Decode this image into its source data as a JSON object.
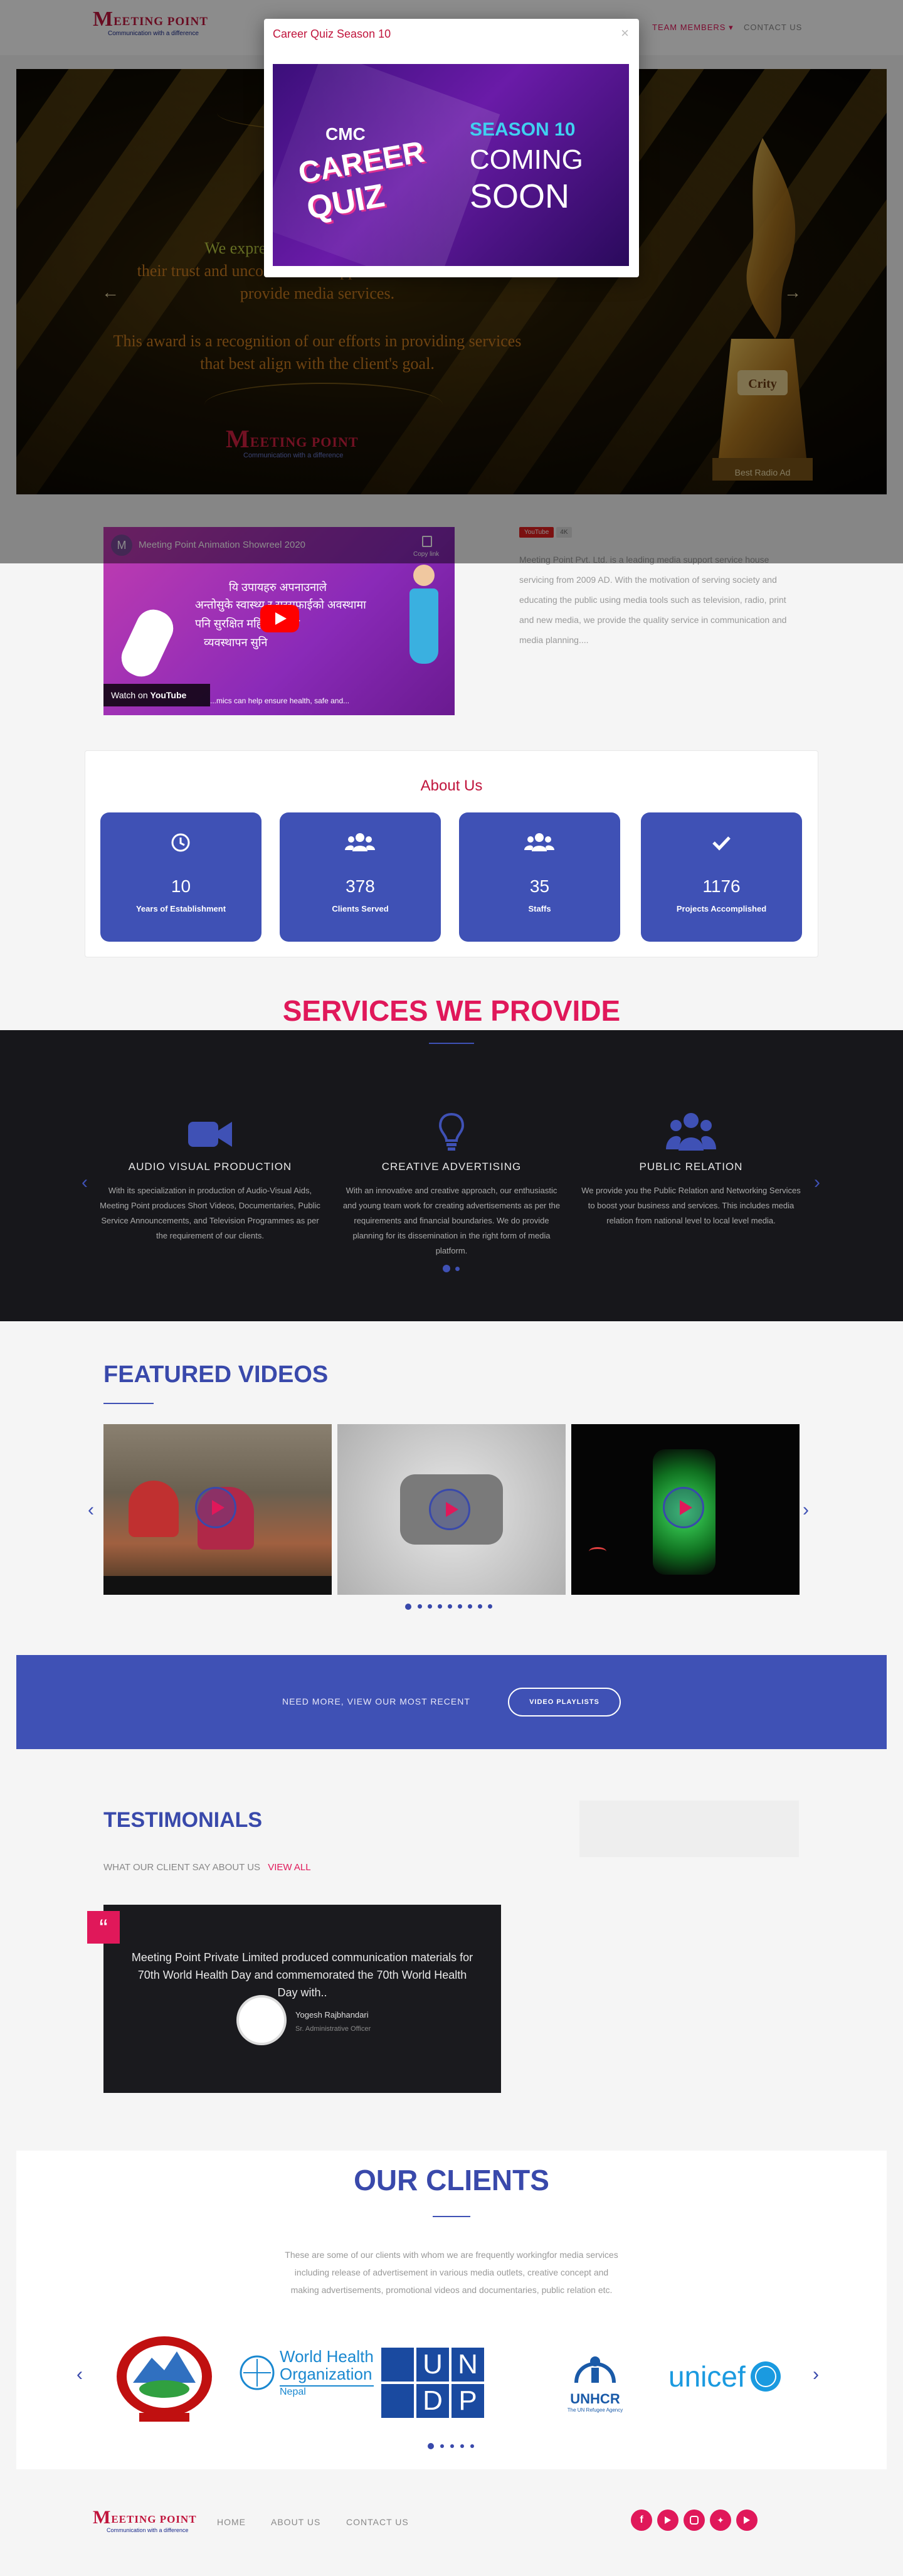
{
  "header": {
    "logo_text": "EETING POINT",
    "logo_letter": "M",
    "logo_tagline": "Communication with a difference",
    "nav": [
      "TEAM MEMBERS",
      "CONTACT US"
    ],
    "nav_caret": "▾"
  },
  "hero": {
    "text1": "We express our",
    "text2": "their trust and unconditional support in our endeavor to",
    "text3": "provide media services.",
    "text4": "This award is a recognition of our efforts in providing services",
    "text5": "that best align with the client's goal.",
    "prev_arrow": "←",
    "next_arrow": "→",
    "trophy_label": "Crity",
    "trophy_caption": "Best Radio Ad"
  },
  "modal": {
    "title": "Career Quiz Season 10",
    "close": "×",
    "img_cmc": "CMC",
    "img_career": "CAREER",
    "img_quiz": "QUIZ",
    "img_season": "SEASON 10",
    "img_coming": "COMING",
    "img_soon": "SOON"
  },
  "video": {
    "channel_letter": "M",
    "title": "Meeting Point Animation Showreel 2020",
    "copy_link": "Copy link",
    "nepali_line1": "यि उपायहरु अपनाउनाले",
    "nepali_line2": "अन्तोसुके स्वास्थ्य र सरसफाईको अवस्थामा",
    "nepali_line3": "पनि सुरक्षित महिनावारीको",
    "nepali_line4": "व्यवस्थापन सुनि",
    "watch_on": "Watch on",
    "youtube": "YouTube",
    "caption": "...mics can help ensure health, safe and...",
    "yt_badge": "YouTube",
    "yt_count": "4K"
  },
  "about_text": "Meeting Point Pvt. Ltd. is a leading media support service house servicing from 2009 AD. With the motivation of serving society and educating the public using media tools such as television, radio, print and new media, we provide the quality service in communication and media planning....",
  "about": {
    "title": "About Us",
    "stats": [
      {
        "icon": "clock-icon",
        "value": "10",
        "label": "Years of Establishment"
      },
      {
        "icon": "users-icon",
        "value": "378",
        "label": "Clients Served"
      },
      {
        "icon": "users-icon",
        "value": "35",
        "label": "Staffs"
      },
      {
        "icon": "check-icon",
        "value": "1176",
        "label": "Projects Accomplished"
      }
    ]
  },
  "services": {
    "title": "SERVICES WE PROVIDE",
    "items": [
      {
        "icon": "video-camera-icon",
        "name": "AUDIO VISUAL PRODUCTION",
        "desc": "With its specialization in production of Audio-Visual Aids, Meeting Point produces Short Videos, Documentaries, Public Service Announcements, and Television Programmes as per the requirement of our clients."
      },
      {
        "icon": "lightbulb-icon",
        "name": "CREATIVE ADVERTISING",
        "desc": "With an innovative and creative approach, our enthusiastic and young team work for creating advertisements as per the requirements and financial boundaries. We do provide planning for its dissemination in the right form of media platform."
      },
      {
        "icon": "users-icon",
        "name": "PUBLIC RELATION",
        "desc": "We provide you the Public Relation and Networking Services to boost your business and services. This includes media relation from national level to local level media."
      }
    ],
    "prev": "‹",
    "next": "›"
  },
  "featured": {
    "title": "FEATURED VIDEOS",
    "prev": "‹",
    "next": "›"
  },
  "banner": {
    "text": "NEED MORE, VIEW OUR MOST RECENT",
    "button": "VIDEO PLAYLISTS"
  },
  "testimonials": {
    "title": "TESTIMONIALS",
    "subtitle": "WHAT OUR CLIENT SAY ABOUT US",
    "view_all": "VIEW ALL",
    "quote_mark": "“",
    "quote": "Meeting Point Private Limited produced communication materials for 70th World Health Day and commemorated the 70th World Health Day with..",
    "author": "Yogesh Rajbhandari",
    "author_role": "Sr. Administrative Officer"
  },
  "clients": {
    "title": "OUR CLIENTS",
    "desc": "These are some of our clients with whom we are frequently workingfor media services including release of advertisement in various media outlets, creative concept and making advertisements, promotional videos and documentaries, public relation etc.",
    "who_line1": "World Health",
    "who_line2": "Organization",
    "who_line3": "Nepal",
    "undp": [
      "U",
      "N",
      "D",
      "P"
    ],
    "unhcr": "UNHCR",
    "unhcr_sub": "The UN Refugee Agency",
    "unicef": "unicef",
    "prev": "‹",
    "next": "›"
  },
  "footer": {
    "links": [
      "HOME",
      "ABOUT US",
      "CONTACT US"
    ],
    "socials": [
      "facebook-icon",
      "youtube-icon",
      "instagram-icon",
      "twitter-icon",
      "youtube-icon"
    ]
  },
  "colors": {
    "brand_red": "#c0143c",
    "accent_pink": "#e0185a",
    "brand_blue": "#3f51b5",
    "dark": "#17171b"
  }
}
